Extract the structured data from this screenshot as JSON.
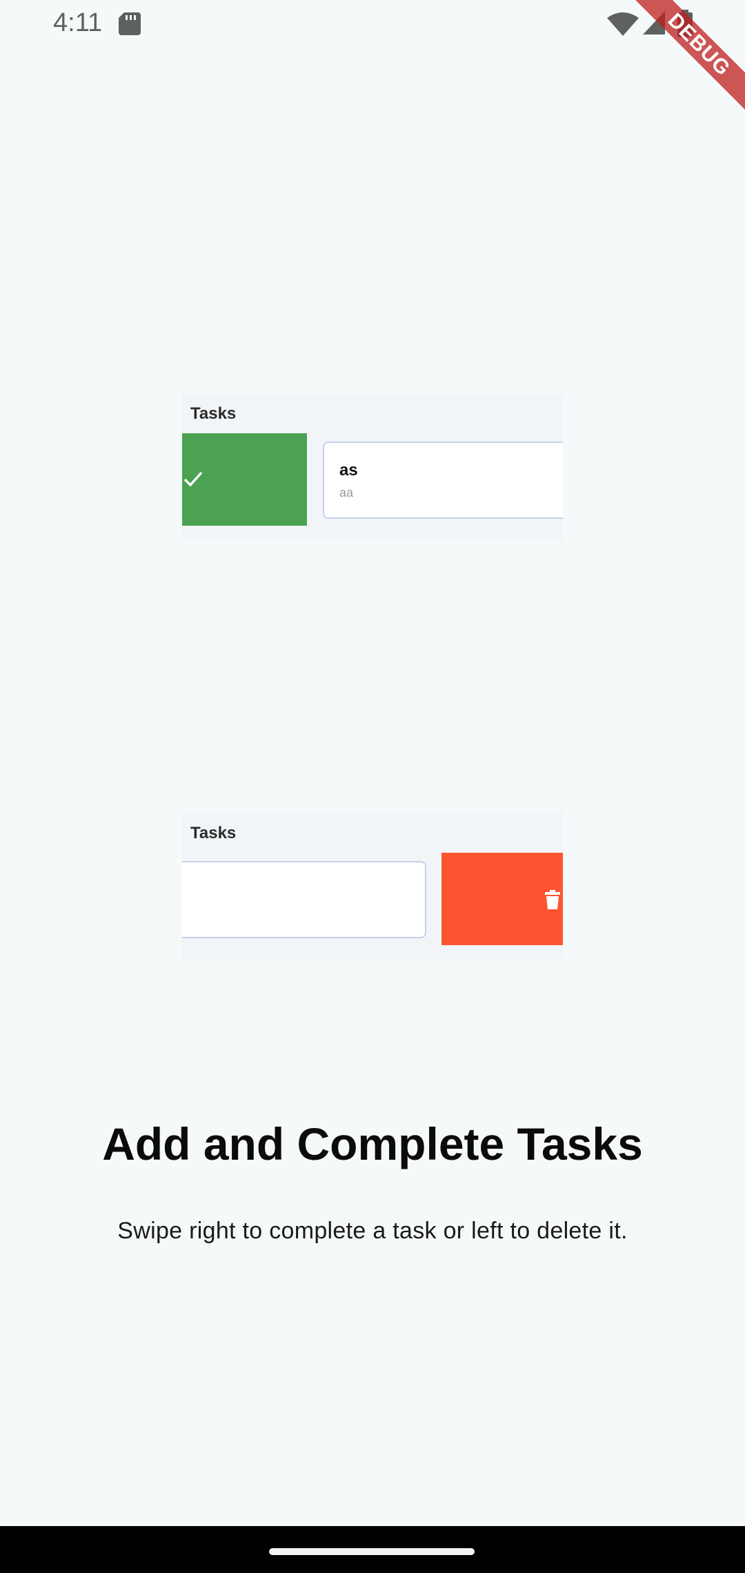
{
  "status_bar": {
    "time": "4:11",
    "icons": [
      "sd-card-icon",
      "wifi-icon",
      "cellular-signal-icon",
      "battery-icon"
    ]
  },
  "debug_banner": {
    "label": "DEBUG",
    "color": "#be1e1e"
  },
  "illustrations": [
    {
      "header": "Tasks",
      "action": "complete",
      "action_icon": "check-icon",
      "action_color": "#4aa252",
      "task": {
        "title": "as",
        "subtitle": "aa"
      }
    },
    {
      "header": "Tasks",
      "action": "delete",
      "action_icon": "trash-icon",
      "action_color": "#fd5533"
    }
  ],
  "onboarding": {
    "title": "Add and Complete Tasks",
    "description": "Swipe right to complete a task or left to delete it."
  },
  "colors": {
    "background": "#f6f9f9",
    "card_border": "#c6d0ec"
  }
}
